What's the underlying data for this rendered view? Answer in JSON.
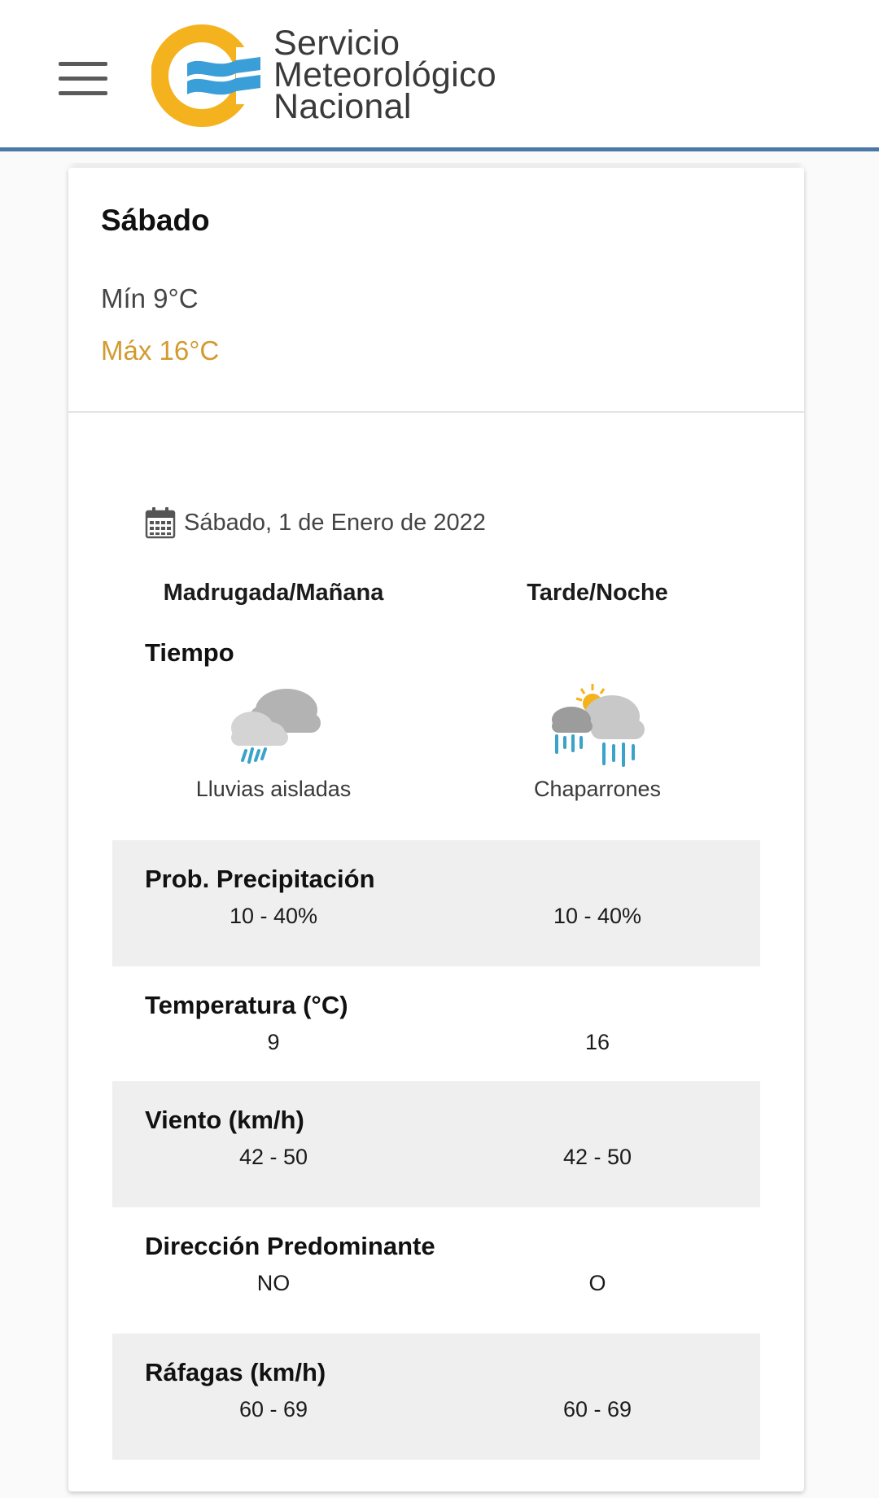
{
  "header": {
    "logo_line1": "Servicio",
    "logo_line2": "Meteorológico",
    "logo_line3": "Nacional",
    "brand_colors": {
      "sun": "#f5b21f",
      "wave": "#3a9fd8",
      "rule": "#4a78a8"
    }
  },
  "day": {
    "name": "Sábado",
    "min": "Mín 9°C",
    "max": "Máx 16°C"
  },
  "detail": {
    "date": "Sábado, 1 de Enero de 2022",
    "col_morning": "Madrugada/Mañana",
    "col_evening": "Tarde/Noche",
    "weather_label": "Tiempo",
    "morning_icon": "isolated-rain-cloud-icon",
    "evening_icon": "showers-sun-cloud-icon",
    "morning_desc": "Lluvias aisladas",
    "evening_desc": "Chaparrones",
    "rows": [
      {
        "label": "Prob. Precipitación",
        "morning": "10 - 40%",
        "evening": "10 - 40%"
      },
      {
        "label": "Temperatura (°C)",
        "morning": "9",
        "evening": "16"
      },
      {
        "label": "Viento (km/h)",
        "morning": "42 - 50",
        "evening": "42 - 50"
      },
      {
        "label": "Dirección Predominante",
        "morning": "NO",
        "evening": "O"
      },
      {
        "label": "Ráfagas (km/h)",
        "morning": "60 - 69",
        "evening": "60 - 69"
      }
    ]
  }
}
